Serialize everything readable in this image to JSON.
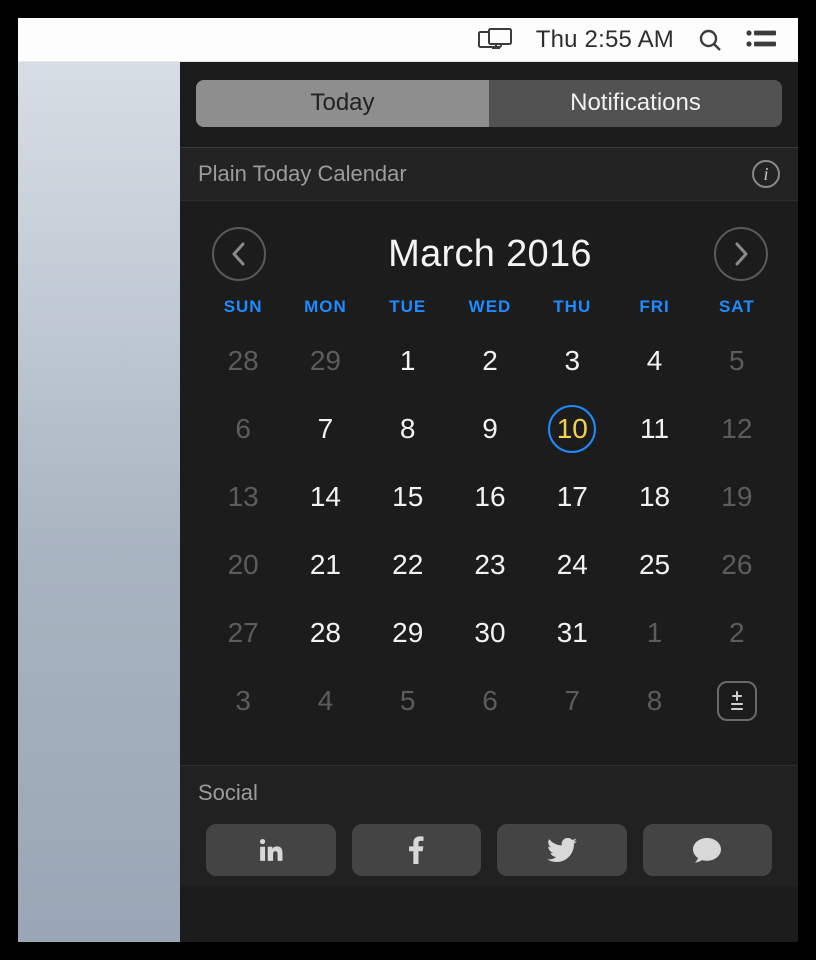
{
  "menubar": {
    "clock": "Thu 2:55 AM"
  },
  "tabs": {
    "today": "Today",
    "notifications": "Notifications",
    "active": "today"
  },
  "widget": {
    "title": "Plain Today Calendar"
  },
  "calendar": {
    "month_label": "March 2016",
    "dow": [
      "SUN",
      "MON",
      "TUE",
      "WED",
      "THU",
      "FRI",
      "SAT"
    ],
    "days": [
      {
        "n": "28",
        "muted": true
      },
      {
        "n": "29",
        "muted": true
      },
      {
        "n": "1"
      },
      {
        "n": "2"
      },
      {
        "n": "3"
      },
      {
        "n": "4"
      },
      {
        "n": "5",
        "muted": true
      },
      {
        "n": "6",
        "muted": true
      },
      {
        "n": "7"
      },
      {
        "n": "8"
      },
      {
        "n": "9"
      },
      {
        "n": "10",
        "today": true
      },
      {
        "n": "11"
      },
      {
        "n": "12",
        "muted": true
      },
      {
        "n": "13",
        "muted": true
      },
      {
        "n": "14"
      },
      {
        "n": "15"
      },
      {
        "n": "16"
      },
      {
        "n": "17"
      },
      {
        "n": "18"
      },
      {
        "n": "19",
        "muted": true
      },
      {
        "n": "20",
        "muted": true
      },
      {
        "n": "21"
      },
      {
        "n": "22"
      },
      {
        "n": "23"
      },
      {
        "n": "24"
      },
      {
        "n": "25"
      },
      {
        "n": "26",
        "muted": true
      },
      {
        "n": "27",
        "muted": true
      },
      {
        "n": "28"
      },
      {
        "n": "29"
      },
      {
        "n": "30"
      },
      {
        "n": "31"
      },
      {
        "n": "1",
        "muted": true
      },
      {
        "n": "2",
        "muted": true
      },
      {
        "n": "3",
        "muted": true
      },
      {
        "n": "4",
        "muted": true
      },
      {
        "n": "5",
        "muted": true
      },
      {
        "n": "6",
        "muted": true
      },
      {
        "n": "7",
        "muted": true
      },
      {
        "n": "8",
        "muted": true
      }
    ]
  },
  "social": {
    "title": "Social",
    "items": [
      "linkedin",
      "facebook",
      "twitter",
      "messages"
    ]
  }
}
